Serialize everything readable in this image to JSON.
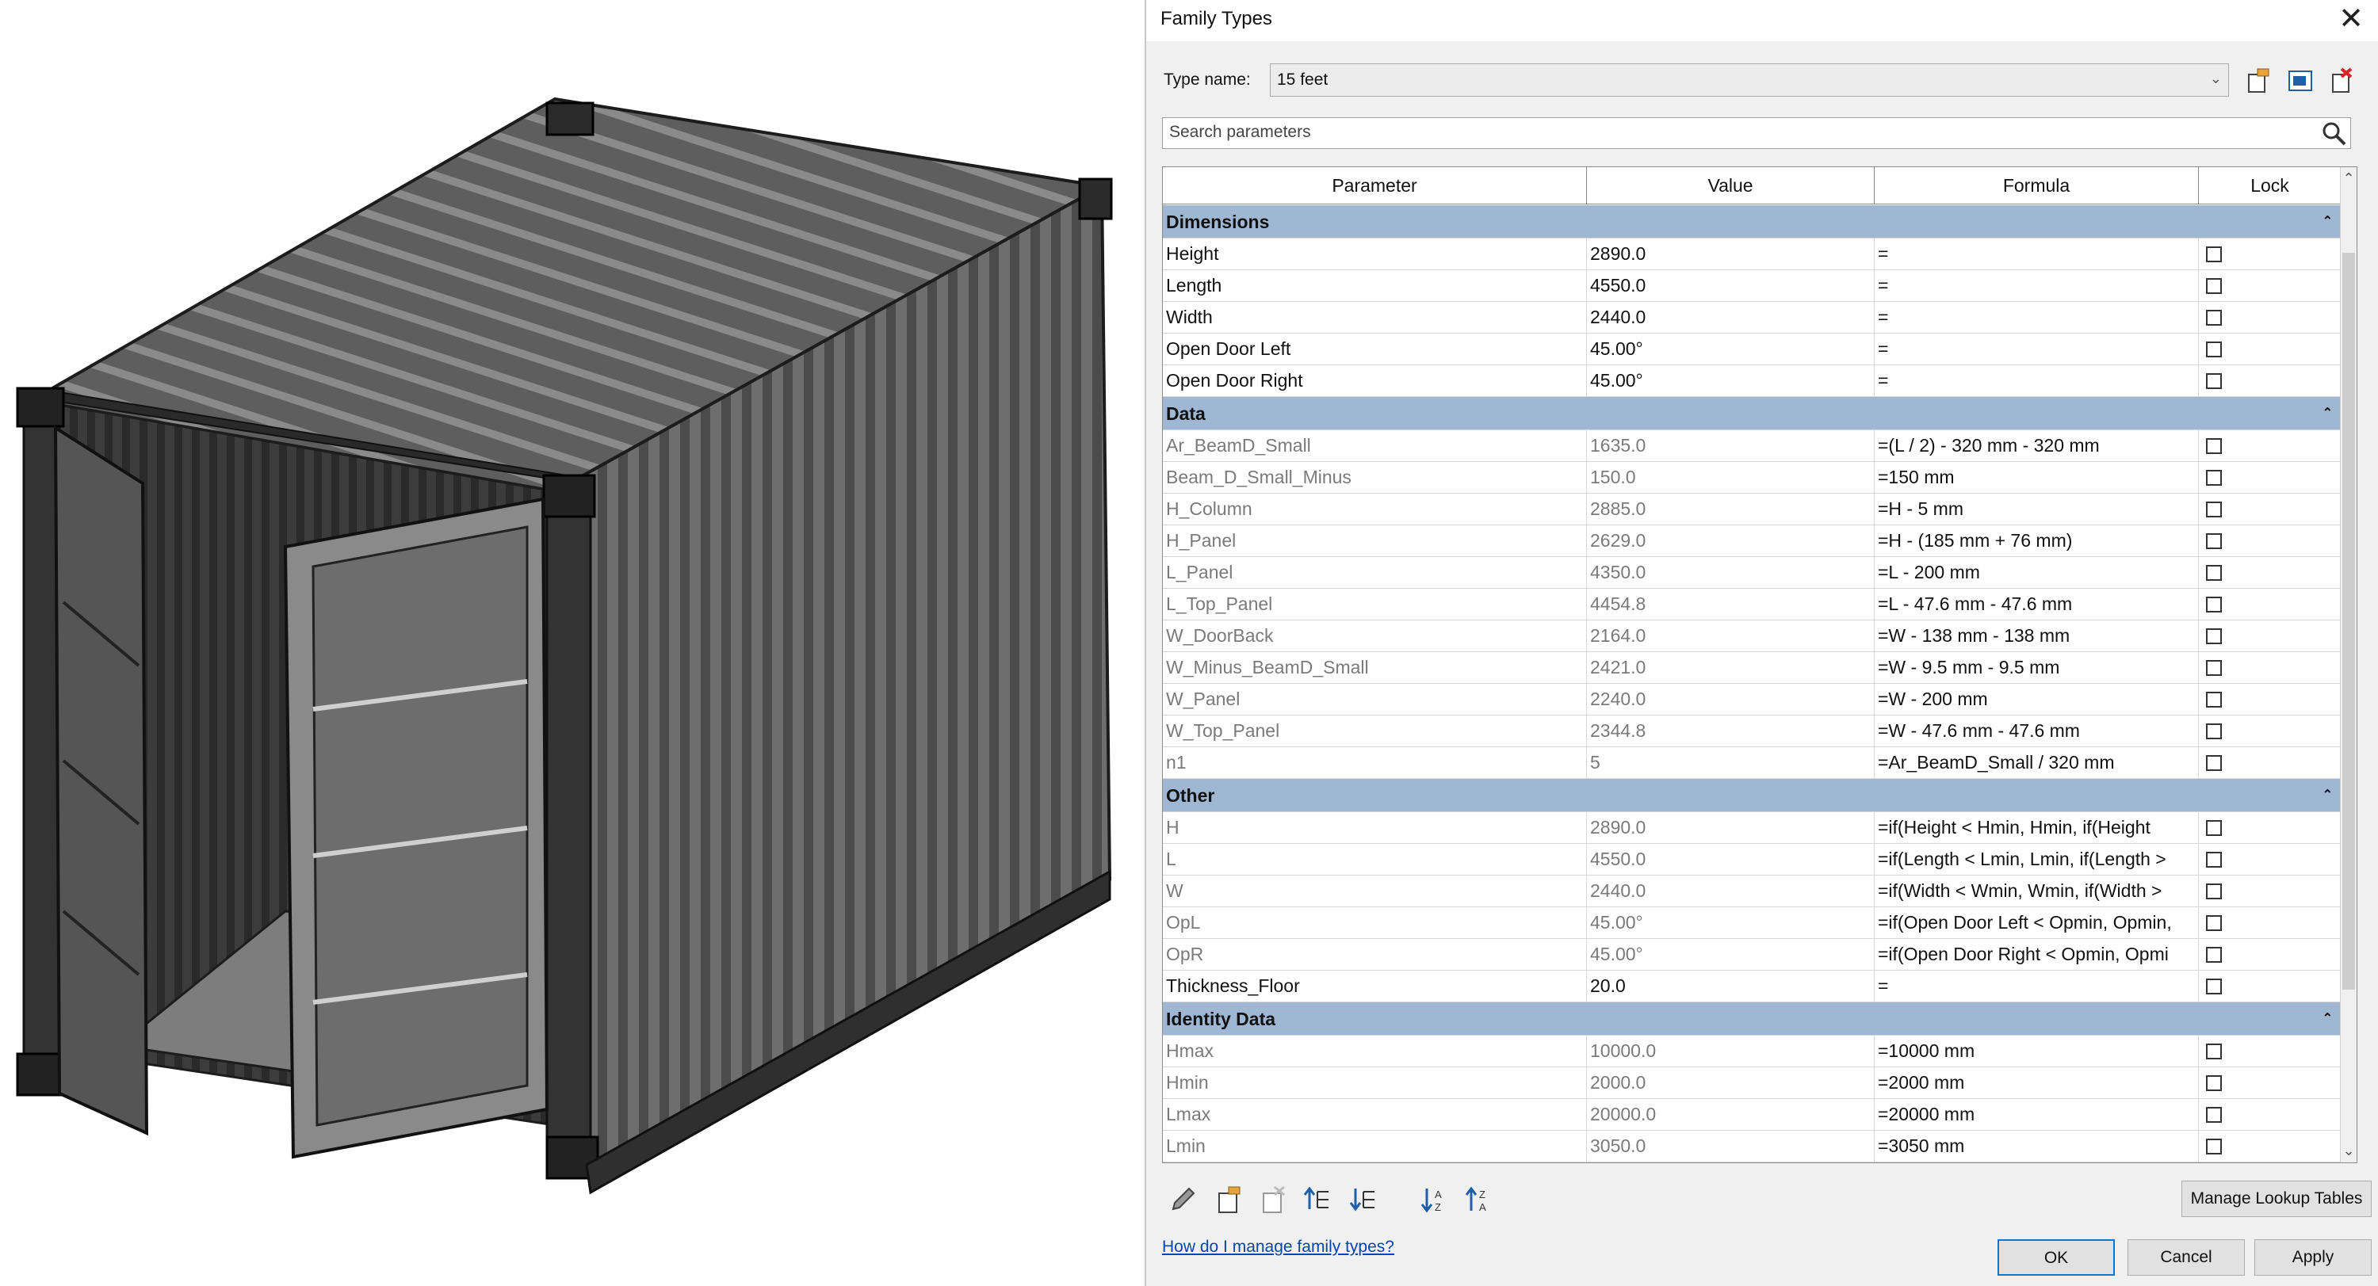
{
  "dialog": {
    "title": "Family Types",
    "type_name_label": "Type name:",
    "type_name_value": "15 feet",
    "search_placeholder": "Search parameters",
    "columns": [
      "Parameter",
      "Value",
      "Formula",
      "Lock"
    ],
    "groups": [
      {
        "name": "Dimensions",
        "rows": [
          {
            "param": "Height",
            "value": "2890.0",
            "formula": "=",
            "readonly": false
          },
          {
            "param": "Length",
            "value": "4550.0",
            "formula": "=",
            "readonly": false
          },
          {
            "param": "Width",
            "value": "2440.0",
            "formula": "=",
            "readonly": false
          },
          {
            "param": "Open Door Left",
            "value": "45.00°",
            "formula": "=",
            "readonly": false
          },
          {
            "param": "Open Door Right",
            "value": "45.00°",
            "formula": "=",
            "readonly": false
          }
        ]
      },
      {
        "name": "Data",
        "rows": [
          {
            "param": "Ar_BeamD_Small",
            "value": "1635.0",
            "formula": "=(L / 2) - 320 mm - 320 mm",
            "readonly": true
          },
          {
            "param": "Beam_D_Small_Minus",
            "value": "150.0",
            "formula": "=150 mm",
            "readonly": true
          },
          {
            "param": "H_Column",
            "value": "2885.0",
            "formula": "=H - 5 mm",
            "readonly": true
          },
          {
            "param": "H_Panel",
            "value": "2629.0",
            "formula": "=H - (185 mm + 76 mm)",
            "readonly": true
          },
          {
            "param": "L_Panel",
            "value": "4350.0",
            "formula": "=L - 200 mm",
            "readonly": true
          },
          {
            "param": "L_Top_Panel",
            "value": "4454.8",
            "formula": "=L - 47.6 mm - 47.6 mm",
            "readonly": true
          },
          {
            "param": "W_DoorBack",
            "value": "2164.0",
            "formula": "=W - 138 mm - 138 mm",
            "readonly": true
          },
          {
            "param": "W_Minus_BeamD_Small",
            "value": "2421.0",
            "formula": "=W - 9.5 mm - 9.5 mm",
            "readonly": true
          },
          {
            "param": "W_Panel",
            "value": "2240.0",
            "formula": "=W - 200 mm",
            "readonly": true
          },
          {
            "param": "W_Top_Panel",
            "value": "2344.8",
            "formula": "=W - 47.6 mm - 47.6 mm",
            "readonly": true
          },
          {
            "param": "n1",
            "value": "5",
            "formula": "=Ar_BeamD_Small / 320 mm",
            "readonly": true
          }
        ]
      },
      {
        "name": "Other",
        "rows": [
          {
            "param": "H",
            "value": "2890.0",
            "formula": "=if(Height < Hmin, Hmin, if(Height",
            "readonly": true
          },
          {
            "param": "L",
            "value": "4550.0",
            "formula": "=if(Length < Lmin, Lmin, if(Length >",
            "readonly": true
          },
          {
            "param": "W",
            "value": "2440.0",
            "formula": "=if(Width < Wmin, Wmin, if(Width >",
            "readonly": true
          },
          {
            "param": "OpL",
            "value": "45.00°",
            "formula": "=if(Open Door Left < Opmin, Opmin,",
            "readonly": true
          },
          {
            "param": "OpR",
            "value": "45.00°",
            "formula": "=if(Open Door Right < Opmin, Opmi",
            "readonly": true
          },
          {
            "param": "Thickness_Floor",
            "value": "20.0",
            "formula": "=",
            "readonly": false
          }
        ]
      },
      {
        "name": "Identity Data",
        "rows": [
          {
            "param": "Hmax",
            "value": "10000.0",
            "formula": "=10000 mm",
            "readonly": true
          },
          {
            "param": "Hmin",
            "value": "2000.0",
            "formula": "=2000 mm",
            "readonly": true
          },
          {
            "param": "Lmax",
            "value": "20000.0",
            "formula": "=20000 mm",
            "readonly": true
          },
          {
            "param": "Lmin",
            "value": "3050.0",
            "formula": "=3050 mm",
            "readonly": true
          }
        ]
      }
    ],
    "buttons": {
      "manage_lookup": "Manage Lookup Tables",
      "help_link": "How do I manage family types?",
      "ok": "OK",
      "cancel": "Cancel",
      "apply": "Apply"
    },
    "icons": [
      "edit-pencil-icon",
      "new-parameter-icon",
      "delete-parameter-icon",
      "move-up-icon",
      "move-down-icon",
      "sort-ascending-icon",
      "sort-descending-icon"
    ],
    "colors": {
      "group_header": "#9fb7d3",
      "primary_border": "#0078d7",
      "link": "#0645ad"
    }
  }
}
